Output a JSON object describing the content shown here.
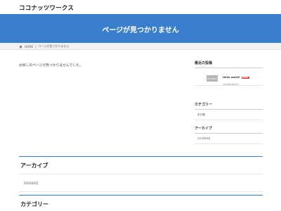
{
  "site": {
    "title": "ココナッツワークス"
  },
  "hero": {
    "title": "ページが見つかりません"
  },
  "breadcrumb": {
    "home": "HOME",
    "separator": "/",
    "current": "ページが見つかりません"
  },
  "main": {
    "message": "お探しのページが見つかりませんでした。"
  },
  "sidebar": {
    "recent_heading": "最近の投稿",
    "recent_post": {
      "thumb_label": "NO IMAGE",
      "title": "Hello world!",
      "badge": "NEW!",
      "date": "2020年09月26日"
    },
    "category_heading": "カテゴリー",
    "category_item": "未分類",
    "archive_heading": "アーカイブ",
    "archive_item": "2020年9月"
  },
  "bottom": {
    "archive_heading": "アーカイブ",
    "archive_item": "2020年9月",
    "category_heading": "カテゴリー"
  },
  "colors": {
    "accent": "#3a7fcd",
    "badge": "#e0393e"
  }
}
